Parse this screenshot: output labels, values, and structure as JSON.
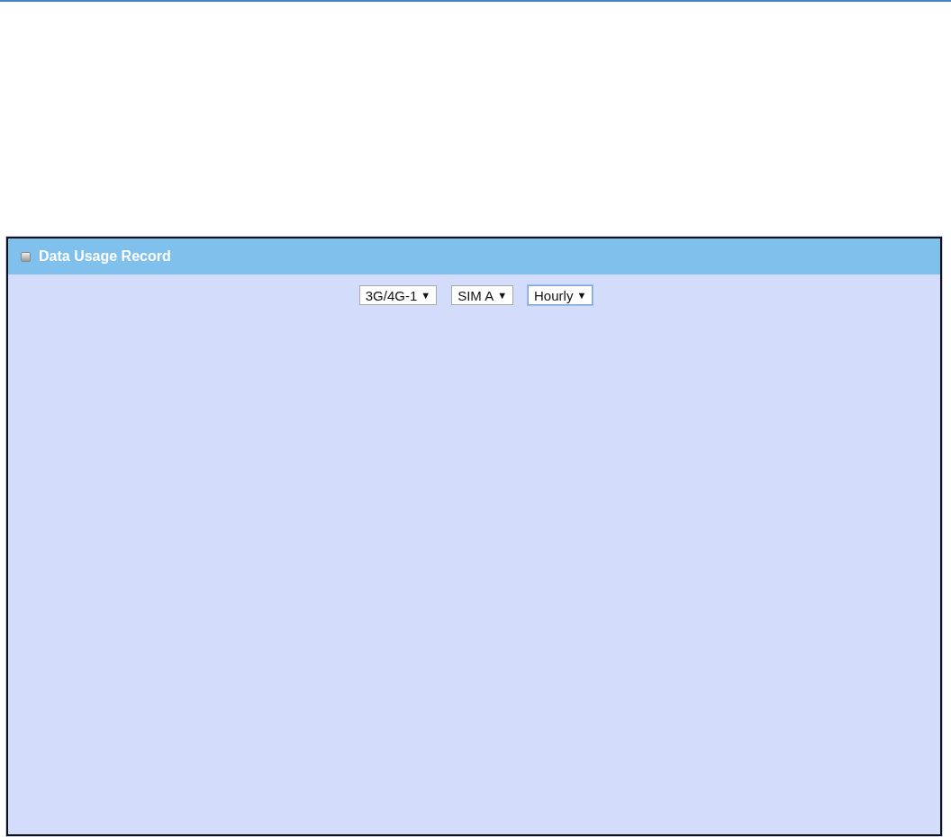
{
  "panel": {
    "title": "Data Usage Record",
    "dropdowns": [
      {
        "value": "3G/4G-1",
        "arrow": "▼",
        "focused": false
      },
      {
        "value": "SIM A",
        "arrow": "▼",
        "focused": false
      },
      {
        "value": "Hourly",
        "arrow": "▼",
        "focused": true
      }
    ]
  }
}
